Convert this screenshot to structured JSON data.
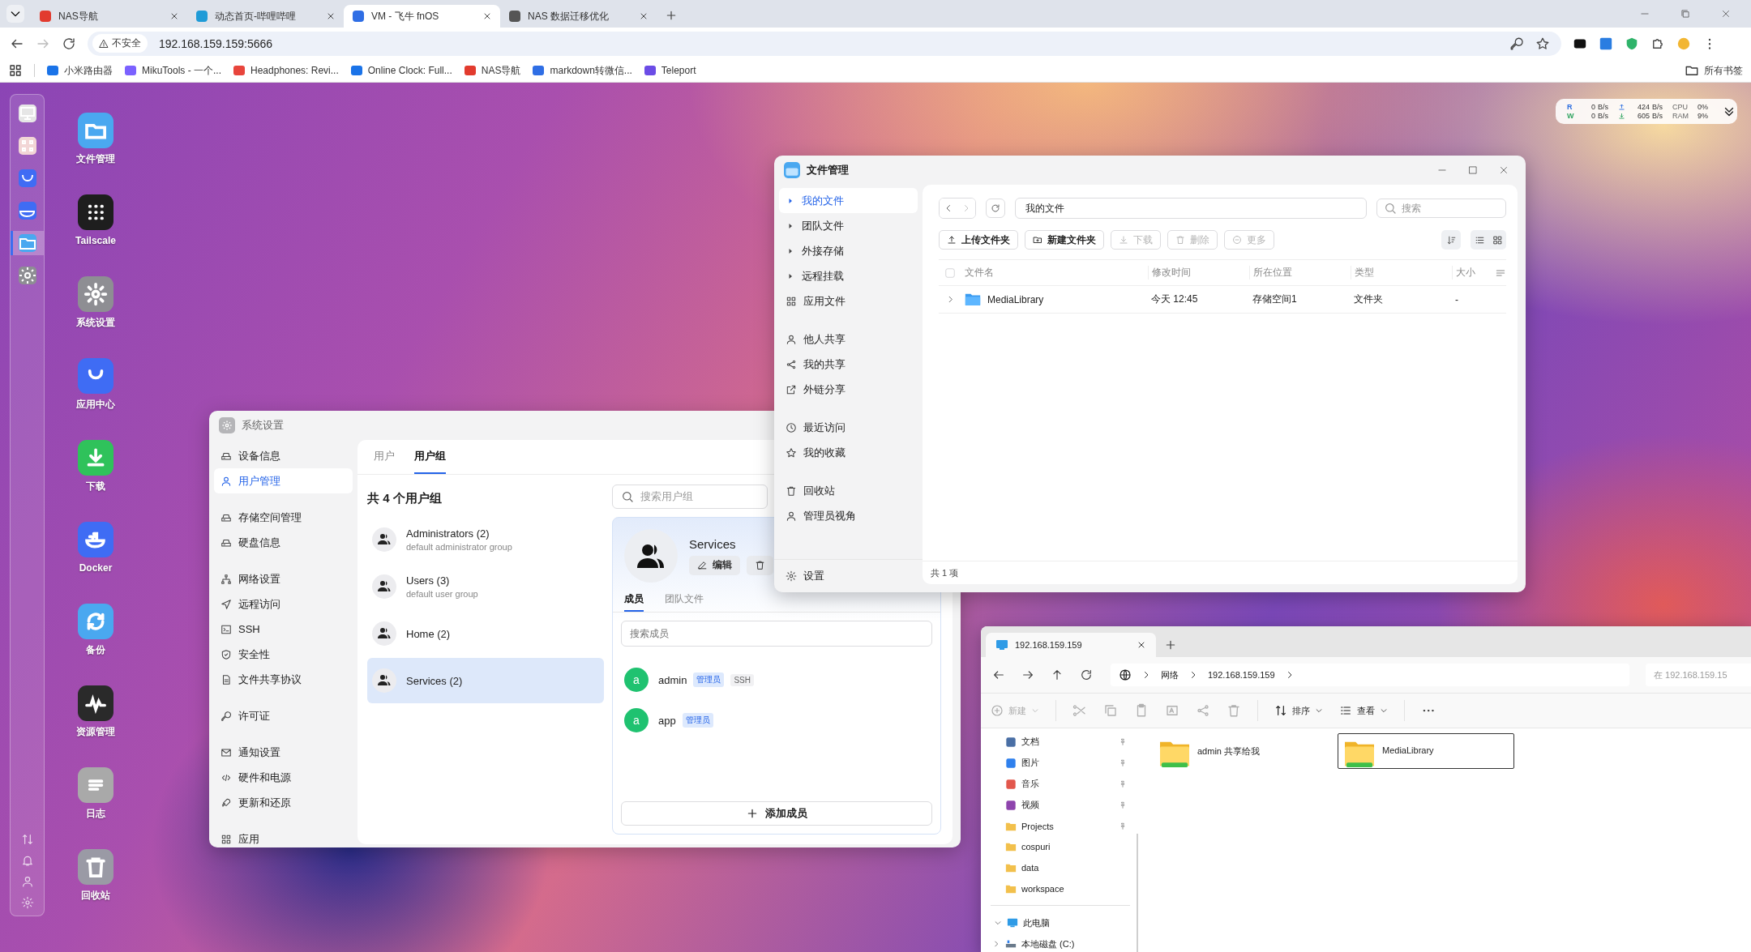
{
  "browser": {
    "tabs": [
      {
        "title": "NAS导航",
        "selected": false
      },
      {
        "title": "动态首页-哔哩哔哩",
        "selected": false
      },
      {
        "title": "VM - 飞牛 fnOS",
        "selected": true
      },
      {
        "title": "NAS 数据迁移优化",
        "selected": false
      }
    ],
    "security": "不安全",
    "address": "192.168.159.159:5666",
    "bookmarks": [
      "小米路由器",
      "MikuTools - 一个...",
      "Headphones: Revi...",
      "Online Clock: Full...",
      "NAS导航",
      "markdown转微信...",
      "Teleport"
    ],
    "all_bookmarks": "所有书签"
  },
  "monitor": {
    "rows": [
      {
        "io": "R",
        "disk": "0",
        "disk_unit": "B/s",
        "net": "424",
        "net_unit": "B/s",
        "metric": "CPU",
        "percent": "0%"
      },
      {
        "io": "W",
        "disk": "0",
        "disk_unit": "B/s",
        "net": "605",
        "net_unit": "B/s",
        "metric": "RAM",
        "percent": "9%"
      }
    ]
  },
  "dock": {
    "apps": [
      {
        "selected": false
      },
      {
        "selected": false
      },
      {
        "selected": false
      },
      {
        "selected": false
      },
      {
        "selected": true
      },
      {
        "selected": false
      }
    ]
  },
  "desktop_icons": [
    "文件管理",
    "Tailscale",
    "系统设置",
    "应用中心",
    "下载",
    "Docker",
    "备份",
    "资源管理",
    "日志",
    "回收站"
  ],
  "settings": {
    "title": "系统设置",
    "sidebar_groups": [
      {
        "items": [
          {
            "label": "设备信息",
            "selected": false
          },
          {
            "label": "用户管理",
            "selected": true
          }
        ]
      },
      {
        "items": [
          {
            "label": "存储空间管理",
            "selected": false
          },
          {
            "label": "硬盘信息",
            "selected": false
          }
        ]
      },
      {
        "items": [
          {
            "label": "网络设置",
            "selected": false
          },
          {
            "label": "远程访问",
            "selected": false
          },
          {
            "label": "SSH",
            "selected": false
          },
          {
            "label": "安全性",
            "selected": false
          },
          {
            "label": "文件共享协议",
            "selected": false
          }
        ]
      },
      {
        "items": [
          {
            "label": "许可证",
            "selected": false
          }
        ]
      },
      {
        "items": [
          {
            "label": "通知设置",
            "selected": false
          },
          {
            "label": "硬件和电源",
            "selected": false
          },
          {
            "label": "更新和还原",
            "selected": false
          }
        ]
      },
      {
        "items": [
          {
            "label": "应用",
            "selected": false
          }
        ]
      }
    ],
    "tabs": [
      {
        "label": "用户",
        "selected": false
      },
      {
        "label": "用户组",
        "selected": true
      }
    ],
    "heading": "共 4 个用户组",
    "search_placeholder": "搜索用户组",
    "groups": [
      {
        "name": "Administrators (2)",
        "description": "default administrator group",
        "selected": false
      },
      {
        "name": "Users (3)",
        "description": "default user group",
        "selected": false
      },
      {
        "name": "Home (2)",
        "selected": false
      },
      {
        "name": "Services (2)",
        "selected": true
      }
    ],
    "detail": {
      "name": "Services",
      "edit": "编辑",
      "tabs": [
        {
          "label": "成员",
          "selected": true
        },
        {
          "label": "团队文件",
          "selected": false
        }
      ],
      "member_placeholder": "搜索成员",
      "members": [
        {
          "avatar": "a",
          "name": "admin",
          "tags": [
            {
              "text": "管理员",
              "kind": "role"
            },
            {
              "text": "SSH",
              "kind": "plain"
            }
          ]
        },
        {
          "avatar": "a",
          "name": "app",
          "tags": [
            {
              "text": "管理员",
              "kind": "role"
            }
          ]
        }
      ],
      "add": "添加成员"
    }
  },
  "file_manager": {
    "title": "文件管理",
    "sidebar_groups": [
      {
        "items": [
          {
            "label": "我的文件",
            "kind": "tree",
            "selected": true
          },
          {
            "label": "团队文件",
            "kind": "tree",
            "selected": false
          },
          {
            "label": "外接存储",
            "kind": "tree",
            "selected": false
          },
          {
            "label": "远程挂载",
            "kind": "tree",
            "selected": false
          },
          {
            "label": "应用文件",
            "kind": "link",
            "selected": false
          }
        ]
      },
      {
        "items": [
          {
            "label": "他人共享",
            "kind": "link",
            "selected": false
          },
          {
            "label": "我的共享",
            "kind": "link",
            "selected": false
          },
          {
            "label": "外链分享",
            "kind": "link",
            "selected": false
          }
        ]
      },
      {
        "items": [
          {
            "label": "最近访问",
            "kind": "link",
            "selected": false
          },
          {
            "label": "我的收藏",
            "kind": "link",
            "selected": false
          }
        ]
      },
      {
        "items": [
          {
            "label": "回收站",
            "kind": "link",
            "selected": false
          },
          {
            "label": "管理员视角",
            "kind": "link",
            "selected": false
          }
        ]
      }
    ],
    "settings": "设置",
    "path": "我的文件",
    "search_placeholder": "搜索",
    "actions": [
      {
        "label": "上传文件夹",
        "disabled": false
      },
      {
        "label": "新建文件夹",
        "disabled": false
      },
      {
        "label": "下载",
        "disabled": true
      },
      {
        "label": "删除",
        "disabled": true
      },
      {
        "label": "更多",
        "disabled": true
      }
    ],
    "select_all": {
      "checked": false
    },
    "columns": [
      "文件名",
      "修改时间",
      "所在位置",
      "类型",
      "大小"
    ],
    "rows": [
      {
        "name": "MediaLibrary",
        "modified": "今天 12:45",
        "location": "存储空间1",
        "type": "文件夹",
        "size": "-"
      }
    ],
    "status": "共 1 项"
  },
  "explorer": {
    "tab": "192.168.159.159",
    "breadcrumbs": [
      "网络",
      "192.168.159.159"
    ],
    "search_placeholder": "在 192.168.159.15",
    "new": {
      "label": "新建",
      "disabled": true
    },
    "sort": "排序",
    "view": "查看",
    "nav": [
      {
        "label": "文档",
        "pinned": true
      },
      {
        "label": "图片",
        "pinned": true
      },
      {
        "label": "音乐",
        "pinned": true
      },
      {
        "label": "视频",
        "pinned": true
      },
      {
        "label": "Projects",
        "pinned": true
      },
      {
        "label": "cospuri",
        "pinned": false
      },
      {
        "label": "data",
        "pinned": false
      },
      {
        "label": "workspace",
        "pinned": false
      }
    ],
    "this_pc": {
      "label": "此电脑",
      "expanded": true
    },
    "drive": {
      "label": "本地磁盘 (C:)",
      "expanded": false
    },
    "items": [
      {
        "name": "admin 共享给我",
        "selected": false
      },
      {
        "name": "MediaLibrary",
        "selected": true
      }
    ]
  }
}
